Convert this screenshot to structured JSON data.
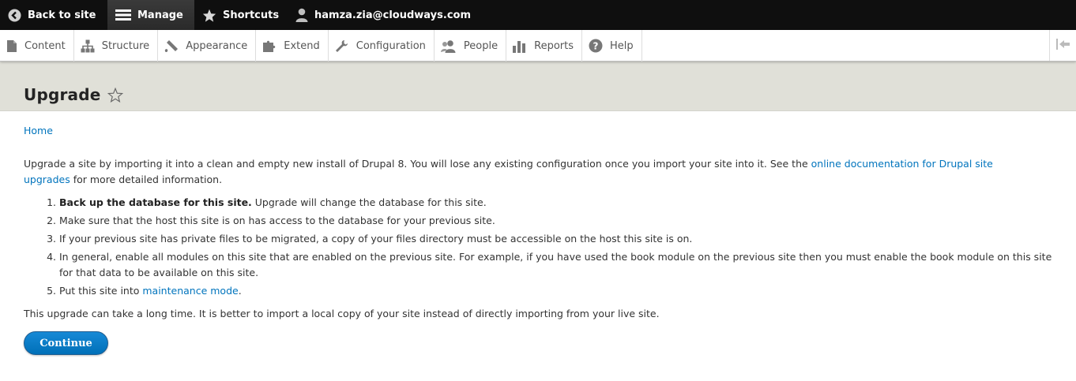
{
  "toolbar": {
    "back_label": "Back to site",
    "manage_label": "Manage",
    "shortcuts_label": "Shortcuts",
    "user_label": "hamza.zia@cloudways.com"
  },
  "tray": {
    "items": [
      {
        "label": "Content",
        "icon": "file-icon"
      },
      {
        "label": "Structure",
        "icon": "sitemap-icon"
      },
      {
        "label": "Appearance",
        "icon": "brush-icon"
      },
      {
        "label": "Extend",
        "icon": "puzzle-icon"
      },
      {
        "label": "Configuration",
        "icon": "wrench-icon"
      },
      {
        "label": "People",
        "icon": "people-icon"
      },
      {
        "label": "Reports",
        "icon": "bar-chart-icon"
      },
      {
        "label": "Help",
        "icon": "help-icon"
      }
    ]
  },
  "page": {
    "title": "Upgrade",
    "breadcrumb": "Home",
    "intro_text_1": "Upgrade a site by importing it into a clean and empty new install of Drupal 8. You will lose any existing configuration once you import your site into it. See the ",
    "intro_link": "online documentation for Drupal site upgrades",
    "intro_text_2": " for more detailed information.",
    "steps": {
      "s1_bold": "Back up the database for this site.",
      "s1_rest": " Upgrade will change the database for this site.",
      "s2": "Make sure that the host this site is on has access to the database for your previous site.",
      "s3": "If your previous site has private files to be migrated, a copy of your files directory must be accessible on the host this site is on.",
      "s4": "In general, enable all modules on this site that are enabled on the previous site. For example, if you have used the book module on the previous site then you must enable the book module on this site for that data to be available on this site.",
      "s5_text": "Put this site into ",
      "s5_link": "maintenance mode",
      "s5_end": "."
    },
    "note": "This upgrade can take a long time. It is better to import a local copy of your site instead of directly importing from your live site.",
    "continue_label": "Continue"
  },
  "colors": {
    "topbar_bg": "#0f0f0f",
    "header_band": "#e0e0d8",
    "link": "#0074bd",
    "button": "#0074bd"
  }
}
